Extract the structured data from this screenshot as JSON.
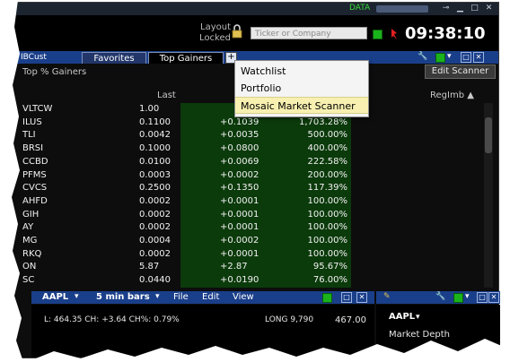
{
  "topbar": {
    "data_label": "DATA"
  },
  "header": {
    "layout_locked": [
      "Layout",
      "Locked"
    ],
    "search_placeholder": "Ticker or Company",
    "clock": "09:38:10"
  },
  "tabs": {
    "ib_logo": "IB",
    "account": "IBCust",
    "items": [
      {
        "label": "Favorites",
        "active": false
      },
      {
        "label": "Top Gainers",
        "active": true
      }
    ],
    "add_symbol": "+"
  },
  "scanner": {
    "title": "Top % Gainers",
    "edit_button": "Edit Scanner",
    "columns": {
      "last": "Last",
      "regimb": "RegImb ▲"
    },
    "rows": [
      {
        "symbol": "VLTCW",
        "last": "1.00",
        "change": "",
        "pct": ""
      },
      {
        "symbol": "ILUS",
        "last": "0.1100",
        "change": "+0.1039",
        "pct": "1,703.28%"
      },
      {
        "symbol": "TLI",
        "last": "0.0042",
        "change": "+0.0035",
        "pct": "500.00%"
      },
      {
        "symbol": "BRSI",
        "last": "0.1000",
        "change": "+0.0800",
        "pct": "400.00%"
      },
      {
        "symbol": "CCBD",
        "last": "0.0100",
        "change": "+0.0069",
        "pct": "222.58%"
      },
      {
        "symbol": "PFMS",
        "last": "0.0003",
        "change": "+0.0002",
        "pct": "200.00%"
      },
      {
        "symbol": "CVCS",
        "last": "0.2500",
        "change": "+0.1350",
        "pct": "117.39%"
      },
      {
        "symbol": "AHFD",
        "last": "0.0002",
        "change": "+0.0001",
        "pct": "100.00%"
      },
      {
        "symbol": "GIH",
        "last": "0.0002",
        "change": "+0.0001",
        "pct": "100.00%"
      },
      {
        "symbol": "AY",
        "last": "0.0002",
        "change": "+0.0001",
        "pct": "100.00%"
      },
      {
        "symbol": "MG",
        "last": "0.0004",
        "change": "+0.0002",
        "pct": "100.00%"
      },
      {
        "symbol": "RKQ",
        "last": "0.0002",
        "change": "+0.0001",
        "pct": "100.00%"
      },
      {
        "symbol": "ON",
        "last": "5.87",
        "change": "+2.87",
        "pct": "95.67%"
      },
      {
        "symbol": "SC",
        "last": "0.0440",
        "change": "+0.0190",
        "pct": "76.00%"
      }
    ]
  },
  "dropdown": {
    "items": [
      "Watchlist",
      "Portfolio",
      "Mosaic Market Scanner"
    ],
    "highlighted_index": 2
  },
  "chart_panel": {
    "symbol": "AAPL",
    "interval": "5 min bars",
    "menus": [
      "File",
      "Edit",
      "View"
    ],
    "quote_line": "L: 464.35 CH: +3.64 CH%: 0.79%",
    "position": "LONG 9,790",
    "price": "467.00"
  },
  "depth_panel": {
    "symbol": "AAPL",
    "title": "Market Depth"
  },
  "colors": {
    "panel_blue": "#1a3f8a",
    "green_column": "#0b3a0b",
    "menu_highlight": "#f7f0b0",
    "data_green": "#3bdc3b"
  }
}
